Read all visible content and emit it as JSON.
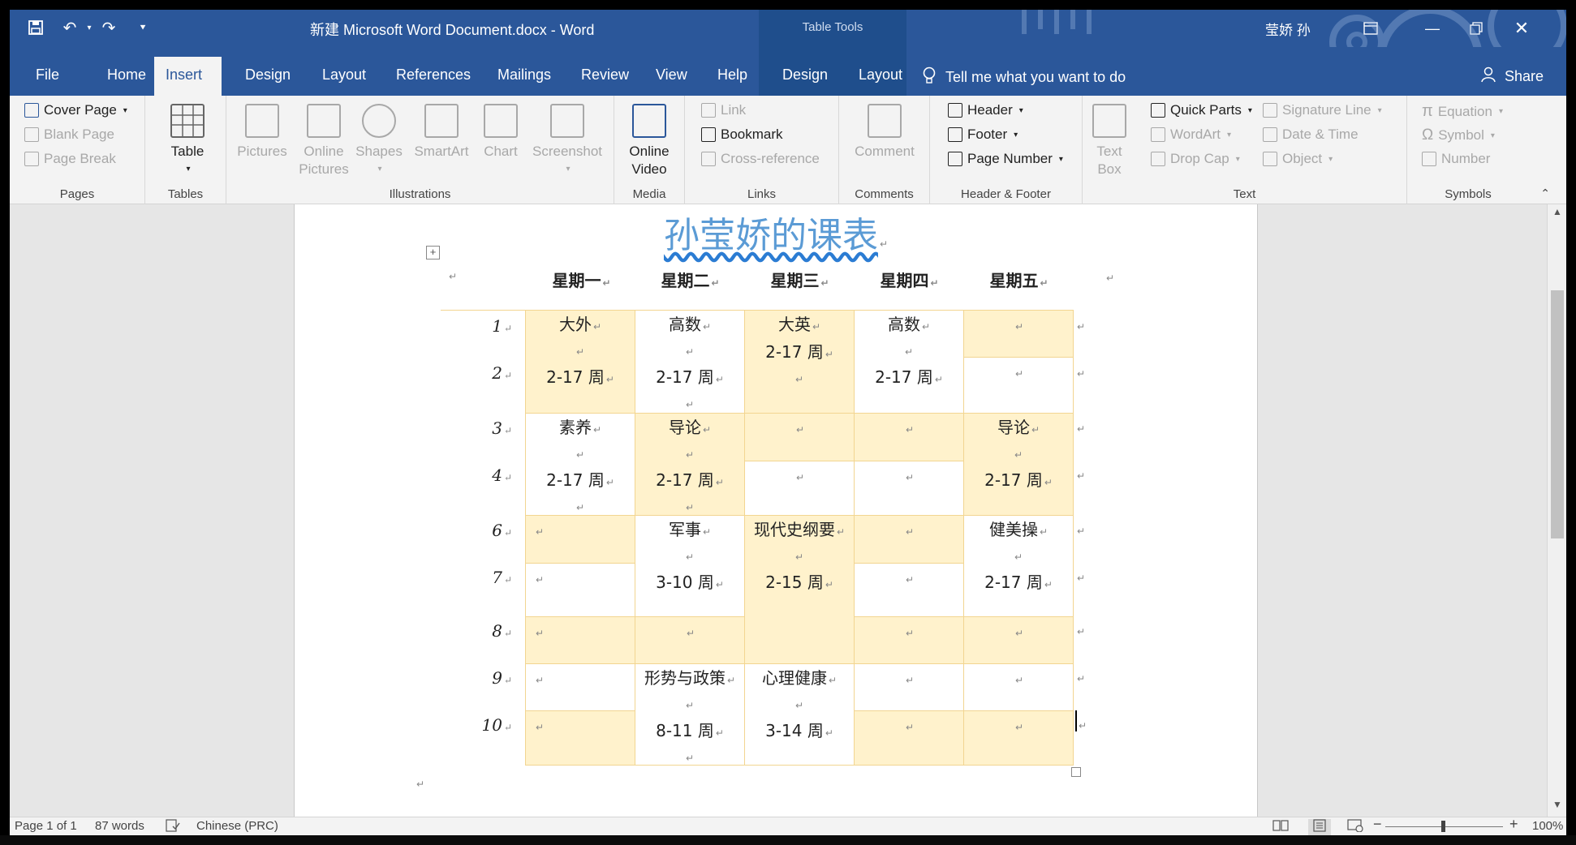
{
  "titlebar": {
    "doc_title": "新建 Microsoft Word Document.docx  -  Word",
    "context_label": "Table Tools",
    "user_name": "莹娇 孙"
  },
  "tabs": [
    "File",
    "Home",
    "Insert",
    "Design",
    "Layout",
    "References",
    "Mailings",
    "Review",
    "View",
    "Help",
    "Design",
    "Layout"
  ],
  "active_tab": "Insert",
  "tell_me": "Tell me what you want to do",
  "share": "Share",
  "ribbon": {
    "pages": {
      "label": "Pages",
      "cover_page": "Cover Page",
      "blank_page": "Blank Page",
      "page_break": "Page Break"
    },
    "tables": {
      "label": "Tables",
      "table": "Table"
    },
    "illustrations": {
      "label": "Illustrations",
      "pictures": "Pictures",
      "online_pictures_1": "Online",
      "online_pictures_2": "Pictures",
      "shapes": "Shapes",
      "smartart": "SmartArt",
      "chart": "Chart",
      "screenshot": "Screenshot"
    },
    "media": {
      "label": "Media",
      "online_video_1": "Online",
      "online_video_2": "Video"
    },
    "links": {
      "label": "Links",
      "link": "Link",
      "bookmark": "Bookmark",
      "cross_reference": "Cross-reference"
    },
    "comments": {
      "label": "Comments",
      "comment": "Comment"
    },
    "header_footer": {
      "label": "Header & Footer",
      "header": "Header",
      "footer": "Footer",
      "page_number": "Page Number"
    },
    "text": {
      "label": "Text",
      "text_box_1": "Text",
      "text_box_2": "Box",
      "quick_parts": "Quick Parts",
      "wordart": "WordArt",
      "drop_cap": "Drop Cap",
      "signature_line": "Signature Line",
      "date_time": "Date & Time",
      "object": "Object"
    },
    "symbols": {
      "label": "Symbols",
      "equation": "Equation",
      "symbol": "Symbol",
      "number": "Number"
    }
  },
  "document": {
    "heading": "孙莹娇的课表",
    "days": [
      "星期一",
      "星期二",
      "星期三",
      "星期四",
      "星期五"
    ],
    "periods": [
      "1",
      "2",
      "3",
      "4",
      "6",
      "7",
      "8",
      "9",
      "10"
    ],
    "courses": {
      "mon_1": "大外",
      "mon_1_weeks": "2-17 周",
      "tue_1": "高数",
      "tue_1_weeks": "2-17 周",
      "wed_1": "大英",
      "wed_1_weeks": "2-17 周",
      "thu_1": "高数",
      "thu_1_weeks": "2-17 周",
      "mon_3": "素养",
      "mon_3_weeks": "2-17 周",
      "tue_3": "导论",
      "tue_3_weeks": "2-17 周",
      "fri_3": "导论",
      "fri_3_weeks": "2-17 周",
      "tue_6": "军事",
      "tue_6_weeks": "3-10 周",
      "wed_6": "现代史纲要",
      "wed_6_weeks": "2-15 周",
      "fri_6": "健美操",
      "fri_6_weeks": "2-17 周",
      "tue_9": "形势与政策",
      "tue_9_weeks": "8-11 周",
      "wed_9": "心理健康",
      "wed_9_weeks": "3-14 周"
    }
  },
  "statusbar": {
    "page": "Page 1 of 1",
    "words": "87 words",
    "language": "Chinese (PRC)",
    "zoom": "100%"
  }
}
